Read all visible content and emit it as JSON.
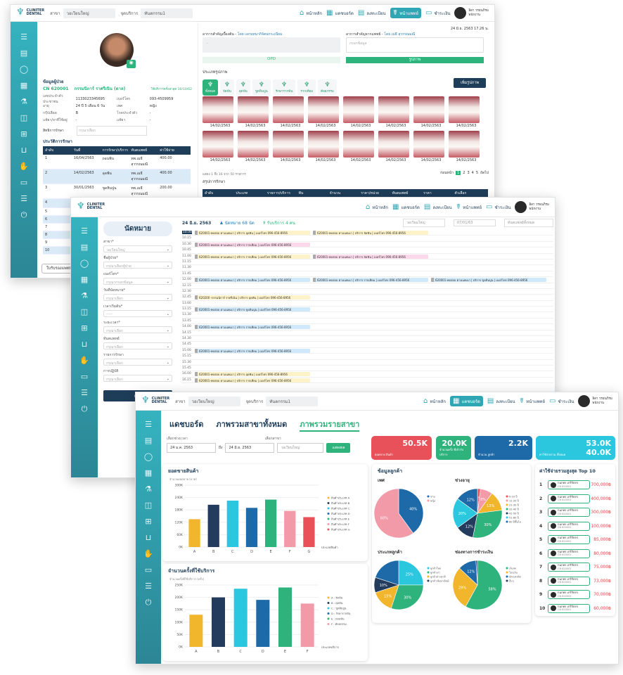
{
  "nav": {
    "home": "หน้าหลัก",
    "dashboard": "แดชบอร์ด",
    "register": "ลงทะเบียน",
    "doctor": "หน้าแพทย์",
    "payment": "ชำระเงิน"
  },
  "brand": {
    "line1": "CLINITER",
    "line2": "DENTAL"
  },
  "user": {
    "name": "ลิสา วรธนภิรม",
    "role": "พนักงาน"
  },
  "w1": {
    "branch_label": "สาขา",
    "branch": "วอเวียนใหญ่",
    "service_label": "จุดบริการ",
    "service": "ทันตกรรม1",
    "datetime": "24 มิ.ย. 2563   17.26 น.",
    "patient_title": "ข้อมูลผู้ป่วย",
    "cn": "CN 620001",
    "name": "กรรมนิการ์ ราศรีเนิน (ตาล)",
    "last_visit": "ใช้บริการครั้งล่าสุด 30/10/62",
    "info": [
      [
        "เลขประจำตัวประชาชน",
        "1133023345695",
        "เบอร์โทร",
        "093-4509959"
      ],
      [
        "อายุ",
        "24 ปี 5 เดือน 6 วัน",
        "เพศ",
        "หญิง"
      ],
      [
        "กรุ๊ปเลือด",
        "B",
        "โรคประจำตัว",
        "-"
      ],
      [
        "แพ้ยา/ยาที่ใช้อยู่",
        "-",
        "แพ้ยา",
        "-"
      ]
    ],
    "rights_label": "สิทธิการรักษา",
    "rights_ph": "กรุณาเลือก",
    "history_title": "ประวัติการรักษา",
    "hist_head": [
      "ลำดับ",
      "วันที่",
      "การรักษา/บริการ",
      "ทันตแพทย์",
      "ค่าใช้จ่าย"
    ],
    "hist": [
      [
        "1",
        "16/04/2563",
        "ถอนฟัน",
        "ทพ.เมธี สุวรรณมณี",
        "400.00"
      ],
      [
        "2",
        "14/02/2563",
        "อุดฟัน",
        "ทพ.เมธี สุวรรณมณี",
        "400.00"
      ],
      [
        "3",
        "30/01/2563",
        "ขูดหินปูน",
        "ทพ.เมธี สุวรรณมณี",
        "200.00"
      ],
      [
        "4",
        "05/12/2562",
        "จัดฟัน",
        "ทพ.ณัฏฐ์ พรรณ",
        "1,000.00"
      ],
      [
        "5",
        "05/11/2562",
        "",
        "",
        ""
      ],
      [
        "6",
        "05/10/2562",
        "",
        "",
        ""
      ],
      [
        "7",
        "05/09/2562",
        "",
        "",
        ""
      ],
      [
        "8",
        "05/08/2562",
        "",
        "",
        ""
      ],
      [
        "9",
        "05/07/2562",
        "",
        "",
        ""
      ],
      [
        "10",
        "05/06/2562",
        "",
        "",
        ""
      ]
    ],
    "bottom_btn": "ใบรับรองแพทย์",
    "sym_label": "อาการสำคัญเบื้องต้น",
    "sym_by": "โดย เอกนทนากิจ์ตนกระเนียม",
    "doc_sym_label": "อาการสำคัญจากแพทย์",
    "doc_sym_by": "โดย เมธี สุวรรณมณี",
    "doc_sym_ph": "กรอกข้อมูล",
    "opd": "OPD",
    "image_btn": "รูปภาพ",
    "image_type_label": "ประเภทรูปภาพ",
    "tabs": [
      "ทั้งหมด",
      "จัดฟัน",
      "อุดฟัน",
      "ขูดหินปูน",
      "รักษารากฟัน",
      "รากเทียม",
      "ศัลยกรรม"
    ],
    "add_image": "เพิ่มรูปภาพ",
    "photo_dates": [
      "14/02/2563",
      "14/02/2563",
      "14/02/2563",
      "14/02/2563",
      "14/02/2563",
      "14/02/2563",
      "14/02/2563",
      "14/02/2563",
      "14/02/2563",
      "14/02/2563",
      "14/02/2563",
      "14/02/2563",
      "14/02/2563",
      "14/02/2563",
      "14/02/2563",
      "14/02/2563"
    ],
    "paging": "แสดง 1 ถึง 16 จาก 50 รายการ",
    "page_lbl": "ก่อนหน้า",
    "pages": [
      "1",
      "2",
      "3",
      "4",
      "5"
    ],
    "next": "ถัดไป",
    "summary_title": "สรุปการรักษา",
    "sum_head": [
      "ลำดับ",
      "ประเภท",
      "รายการ/บริการ",
      "ฟัน",
      "จำนวน",
      "ราคา/หน่วย",
      "ทันตแพทย์",
      "ราคา",
      "ตัวเลือก"
    ]
  },
  "w2": {
    "title": "นัดหมาย",
    "date": "24 มิ.ย. 2563",
    "count1": "นัดหมาย 68 นัด",
    "count2": "รับบริการ 4 คน",
    "branch_sel": "วอเวียนใหญ่",
    "date_sel": "07/01/63",
    "doc_sel": "ทันตแพทย์ทั้งหมด",
    "fields": [
      [
        "สาขา*",
        "วอเวียนใหญ่"
      ],
      [
        "ชื่อผู้ป่วย*",
        "กรุณาเลือกผู้ป่วย"
      ],
      [
        "เบอร์โทร*",
        "กรุณากรอกข้อมูล"
      ],
      [
        "วันที่นัดหมาย*",
        "กรุณาเลือก"
      ],
      [
        "เวลาเริ่มต้น*",
        "--:--"
      ],
      [
        "ระยะเวลา*",
        "กรุณาเลือก"
      ],
      [
        "ทันตแพทย์",
        "กรุณาเลือก"
      ],
      [
        "รายการรักษา",
        "กรุณาเลือก"
      ],
      [
        "การปฏิบัติ",
        "กรุณาเลือก"
      ]
    ],
    "add_btn": "เพิ่ม",
    "times": [
      "10.00",
      "10.15",
      "10.30",
      "10.45",
      "11.00",
      "11.15",
      "11.30",
      "11.45",
      "12.00",
      "12.15",
      "12.30",
      "12.45",
      "13.00",
      "13.15",
      "13.30",
      "13.45",
      "14.00",
      "14.15",
      "14.30",
      "14.45",
      "15.00",
      "15.15",
      "15.30",
      "15.45",
      "16.00",
      "16.15"
    ],
    "appts": [
      {
        "row": 0,
        "col": 0,
        "cls": "y",
        "text": "620001-ทดสอบ ตามนพเนา | บริการ อุดฟัน | เบอร์โทร 096-456-8956"
      },
      {
        "row": 0,
        "col": 1,
        "cls": "y",
        "text": "620001-ทดสอบ ตามนพเนา | บริการ จัดฟัน | เบอร์โทร 096-456-8956"
      },
      {
        "row": 2,
        "col": 0,
        "cls": "p",
        "text": "620001-ทดสอบ ตามนพเนา | บริการ รากเทียม | เบอร์โทร 096-456-8956"
      },
      {
        "row": 4,
        "col": 0,
        "cls": "y",
        "text": "620001-ทดสอบ ตามนพเนา | บริการ รากเทียม | เบอร์โทร 096-456-8956"
      },
      {
        "row": 4,
        "col": 1,
        "cls": "p",
        "text": "620001-ทดสอบ ตามนพเนา | บริการ จัดฟัน | เบอร์โทร 096-456-8956"
      },
      {
        "row": 8,
        "col": 0,
        "cls": "b",
        "text": "620001-ทดสอบ ตามนพเนา | บริการ รากเทียม | เบอร์โทร 096-456-8956"
      },
      {
        "row": 8,
        "col": 1,
        "cls": "b",
        "text": "620001-ทดสอบ ตามนพเนา | บริการ รากเทียม | เบอร์โทร 096-456-8956"
      },
      {
        "row": 8,
        "col": 2,
        "cls": "b",
        "text": "620001-ทดสอบ ตามนพเนา | บริการ ขูดหินปูน | เบอร์โทร 096-456-8956"
      },
      {
        "row": 11,
        "col": 0,
        "cls": "y",
        "text": "620200 -กรรมนิการ์ ราศรีเนิน | บริการ อุดฟัน | เบอร์โทร 096-456-8956"
      },
      {
        "row": 13,
        "col": 0,
        "cls": "b",
        "text": "620001-ทดสอบ ตามนพเนา | บริการ ขูดหินปูน | เบอร์โทร 096-456-8956"
      },
      {
        "row": 16,
        "col": 0,
        "cls": "b",
        "text": "620001-ทดสอบ ตามนพเนา | บริการ รากเทียม | เบอร์โทร 096-456-8956"
      },
      {
        "row": 20,
        "col": 0,
        "cls": "b",
        "text": "620001-ทดสอบ ตามนพเนา | บริการ รากเทียม | เบอร์โทร 096-456-8956"
      },
      {
        "row": 24,
        "col": 0,
        "cls": "y",
        "text": "620001-ทดสอบ ตามนพเนา | บริการ อุดฟัน | เบอร์โทร 096-456-8956"
      },
      {
        "row": 25,
        "col": 0,
        "cls": "y",
        "text": "620001-ทดสอบ ตามนพเนา | บริการ รากเทียม | เบอร์โทร 096-456-8956"
      }
    ]
  },
  "w3": {
    "tabs": [
      "แดชบอร์ด",
      "ภาพรวมสาขาทั้งหมด",
      "ภาพรวมรายสาขา"
    ],
    "from_label": "เลือกช่วงเวลา",
    "from": "24 ม.ค. 2563",
    "to_lbl": "ถึง",
    "to": "24 มิ.ย. 2563",
    "branch_label": "เลือกสาขา",
    "branch": "วอเวียนใหญ่",
    "show_btn": "แสดงผล",
    "kpis": [
      {
        "value": "50.5K",
        "label": "ยอดขาย สินค้า",
        "color": "#e9515a"
      },
      {
        "value": "20.0K",
        "label": "จำนวนครั้ง ที่เข้ารับบริการ",
        "color": "#2fb37c"
      },
      {
        "value": "2.2K",
        "label": "จำนวน ลูกค้า",
        "color": "#1e6aa8"
      },
      {
        "value": "53.0K",
        "value2": "40.0K",
        "label": "ค่าใช้จ่ายรวม ทั้งหมด",
        "color": "#2ac7de"
      }
    ],
    "sales_title": "ยอดขายสินค้า",
    "visits_title": "จำนวนครั้งที่ใช้บริการ",
    "cust_title": "ข้อมูลลูกค้า",
    "gender_title": "เพศ",
    "age_title": "ช่วงอายุ",
    "type_title": "ประเภทลูกค้า",
    "pay_title": "ช่องทางการชำระเงิน",
    "top_title": "ค่าใช้จ่ายรวมสูงสุด Top 10",
    "top": [
      [
        "1",
        "700,000฿"
      ],
      [
        "2",
        "400,000฿"
      ],
      [
        "3",
        "300,000฿"
      ],
      [
        "4",
        "100,000฿"
      ],
      [
        "5",
        "85,000฿"
      ],
      [
        "6",
        "80,000฿"
      ],
      [
        "7",
        "75,000฿"
      ],
      [
        "8",
        "73,000฿"
      ],
      [
        "9",
        "70,000฿"
      ],
      [
        "10",
        "60,000฿"
      ]
    ],
    "top_name": "กนกพร เกริกิตกร",
    "top_cn": "CN 620001"
  },
  "chart_data": [
    {
      "type": "bar",
      "title": "ยอดขายสินค้า",
      "categories": [
        "A",
        "B",
        "C",
        "D",
        "E",
        "F",
        "G"
      ],
      "values": [
        135000,
        205000,
        225000,
        190000,
        230000,
        175000,
        145000
      ],
      "ylim": [
        0,
        300000
      ],
      "ylabel": "จำนวนยอดขาย (บาท)",
      "xlabel": "ประเภทสินค้า",
      "colors": [
        "#f2b62d",
        "#233c5e",
        "#2ac7de",
        "#1e6aa8",
        "#2fb37c",
        "#f29aa8",
        "#e9515a"
      ],
      "legend": [
        "สินค้าประเภท A",
        "สินค้าประเภท B",
        "สินค้าประเภท C",
        "สินค้าประเภท D",
        "สินค้าประเภท E",
        "สินค้าประเภท F",
        "สินค้าประเภท G"
      ]
    },
    {
      "type": "bar",
      "title": "จำนวนครั้งที่ใช้บริการ",
      "categories": [
        "A",
        "B",
        "C",
        "D",
        "E",
        "F"
      ],
      "values": [
        130000,
        200000,
        235000,
        190000,
        240000,
        175000
      ],
      "ylim": [
        0,
        250000
      ],
      "ylabel": "จำนวนครั้งที่ใช้บริการ (ครั้ง)",
      "xlabel": "ประเภทบริการ",
      "colors": [
        "#f2b62d",
        "#233c5e",
        "#2ac7de",
        "#1e6aa8",
        "#2fb37c",
        "#f29aa8"
      ],
      "legend": [
        "A : จัดฟัน",
        "B : อุดฟัน",
        "C : ขูดหินปูน",
        "D : รักษารากฟัน",
        "E : ถอนฟัน",
        "F : ศัลยกรรม"
      ]
    },
    {
      "type": "pie",
      "title": "เพศ",
      "values": [
        40,
        60
      ],
      "labels": [
        "40%",
        "60%"
      ],
      "legend": [
        "ชาย",
        "หญิง"
      ],
      "colors": [
        "#1e6aa8",
        "#f29aa8"
      ]
    },
    {
      "type": "pie",
      "title": "ช่วงอายุ",
      "values": [
        2,
        8,
        13,
        30,
        12,
        20,
        15
      ],
      "labels": [
        "2%",
        "8%",
        "13%",
        "30%",
        "12%",
        "20%",
        "12%"
      ],
      "legend": [
        "0-10 ปี",
        "11-20 ปี",
        "21-30 ปี",
        "31-40 ปี",
        "41-50 ปี",
        "51-60 ปี",
        "60 ปีขึ้นไป"
      ],
      "colors": [
        "#e9515a",
        "#f29aa8",
        "#f2b62d",
        "#2fb37c",
        "#233c5e",
        "#2ac7de",
        "#1e6aa8"
      ]
    },
    {
      "type": "pie",
      "title": "ประเภทลูกค้า",
      "values": [
        25,
        30,
        15,
        10,
        20
      ],
      "labels": [
        "25%",
        "30%",
        "15%",
        "10%",
        ""
      ],
      "legend": [
        "ลูกค้าใหม่",
        "ลูกค้าเก่า",
        "ลูกค้าต่างชาติ",
        "ลูกค้าเชิงพาณิชย์"
      ],
      "colors": [
        "#2ac7de",
        "#2fb37c",
        "#f2b62d",
        "#233c5e",
        "#1e6aa8"
      ]
    },
    {
      "type": "pie",
      "title": "ช่องทางการชำระเงิน",
      "values": [
        58,
        29,
        12,
        1
      ],
      "labels": [
        "58%",
        "29%",
        "12%",
        ""
      ],
      "legend": [
        "เงินสด",
        "โอนเงิน",
        "บัตรเครดิต",
        "อื่นๆ"
      ],
      "colors": [
        "#2fb37c",
        "#f2b62d",
        "#1e6aa8",
        "#233c5e"
      ]
    }
  ]
}
